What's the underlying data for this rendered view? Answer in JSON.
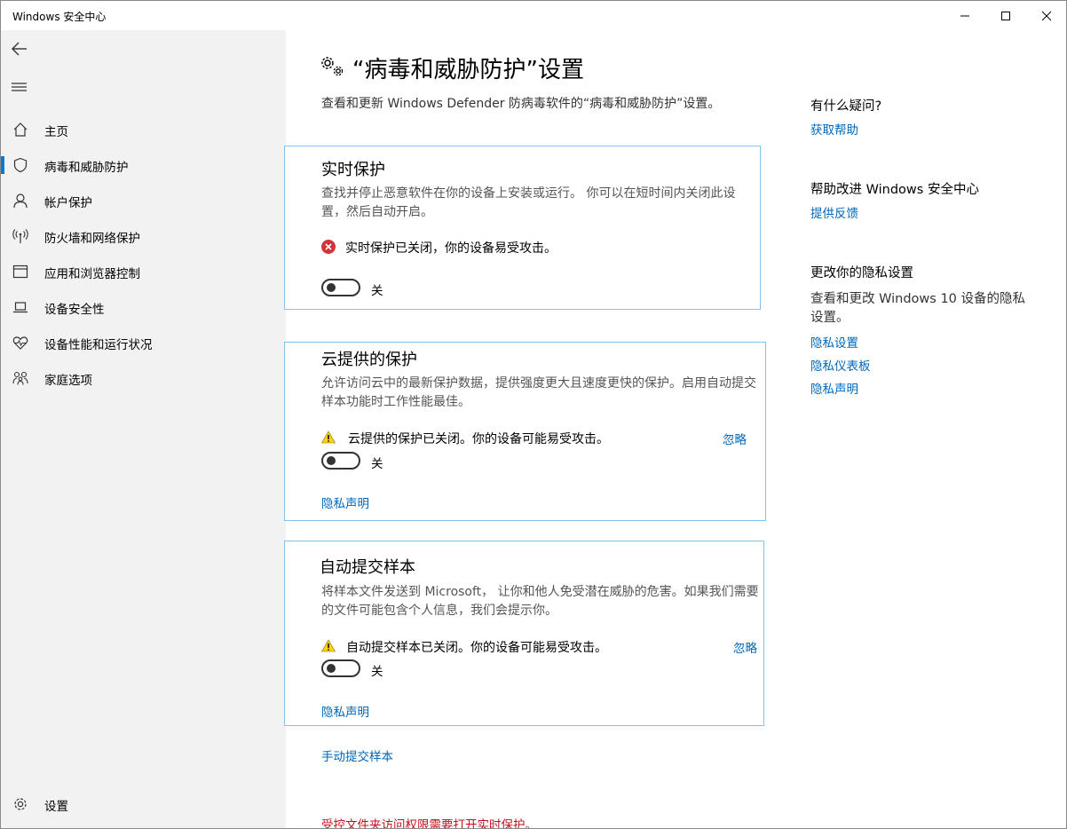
{
  "window": {
    "title": "Windows 安全中心"
  },
  "sidebar": {
    "items": [
      {
        "label": "主页",
        "icon": "home-icon"
      },
      {
        "label": "病毒和威胁防护",
        "icon": "shield-icon",
        "active": true
      },
      {
        "label": "帐户保护",
        "icon": "person-icon"
      },
      {
        "label": "防火墙和网络保护",
        "icon": "wireless-icon"
      },
      {
        "label": "应用和浏览器控制",
        "icon": "app-window-icon"
      },
      {
        "label": "设备安全性",
        "icon": "laptop-icon"
      },
      {
        "label": "设备性能和运行状况",
        "icon": "heart-icon"
      },
      {
        "label": "家庭选项",
        "icon": "family-icon"
      }
    ],
    "settings_label": "设置"
  },
  "main": {
    "title": "“病毒和威胁防护”设置",
    "description": "查看和更新 Windows Defender 防病毒软件的“病毒和威胁防护”设置。",
    "realtime": {
      "title": "实时保护",
      "description": "查找并停止恶意软件在你的设备上安装或运行。 你可以在短时间内关闭此设置，然后自动开启。",
      "status": "实时保护已关闭，你的设备易受攻击。",
      "toggle_label": "关"
    },
    "cloud": {
      "title": "云提供的保护",
      "description": "允许访问云中的最新保护数据，提供强度更大且速度更快的保护。启用自动提交样本功能时工作性能最佳。",
      "status": "云提供的保护已关闭。你的设备可能易受攻击。",
      "dismiss": "忽略",
      "toggle_label": "关",
      "privacy_link": "隐私声明"
    },
    "sample": {
      "title": "自动提交样本",
      "description": "将样本文件发送到 Microsoft， 让你和他人免受潜在威胁的危害。如果我们需要的文件可能包含个人信息，我们会提示你。",
      "status": "自动提交样本已关闭。你的设备可能易受攻击。",
      "dismiss": "忽略",
      "toggle_label": "关",
      "privacy_link": "隐私声明"
    },
    "manual_submit_link": "手动提交样本",
    "cfa_warning": "受控文件夹访问权限需要打开实时保护。"
  },
  "right": {
    "question_heading": "有什么疑问?",
    "help_link": "获取帮助",
    "improve_heading": "帮助改进 Windows 安全中心",
    "feedback_link": "提供反馈",
    "privacy_heading": "更改你的隐私设置",
    "privacy_text": "查看和更改 Windows 10 设备的隐私设置。",
    "privacy_settings_link": "隐私设置",
    "privacy_dashboard_link": "隐私仪表板",
    "privacy_statement_link": "隐私声明"
  },
  "colors": {
    "accent": "#0067b8",
    "card_border": "#86c1ea",
    "error": "#d13438",
    "warning": "#fcd116",
    "sidebar_bg": "#f2f2f2"
  }
}
